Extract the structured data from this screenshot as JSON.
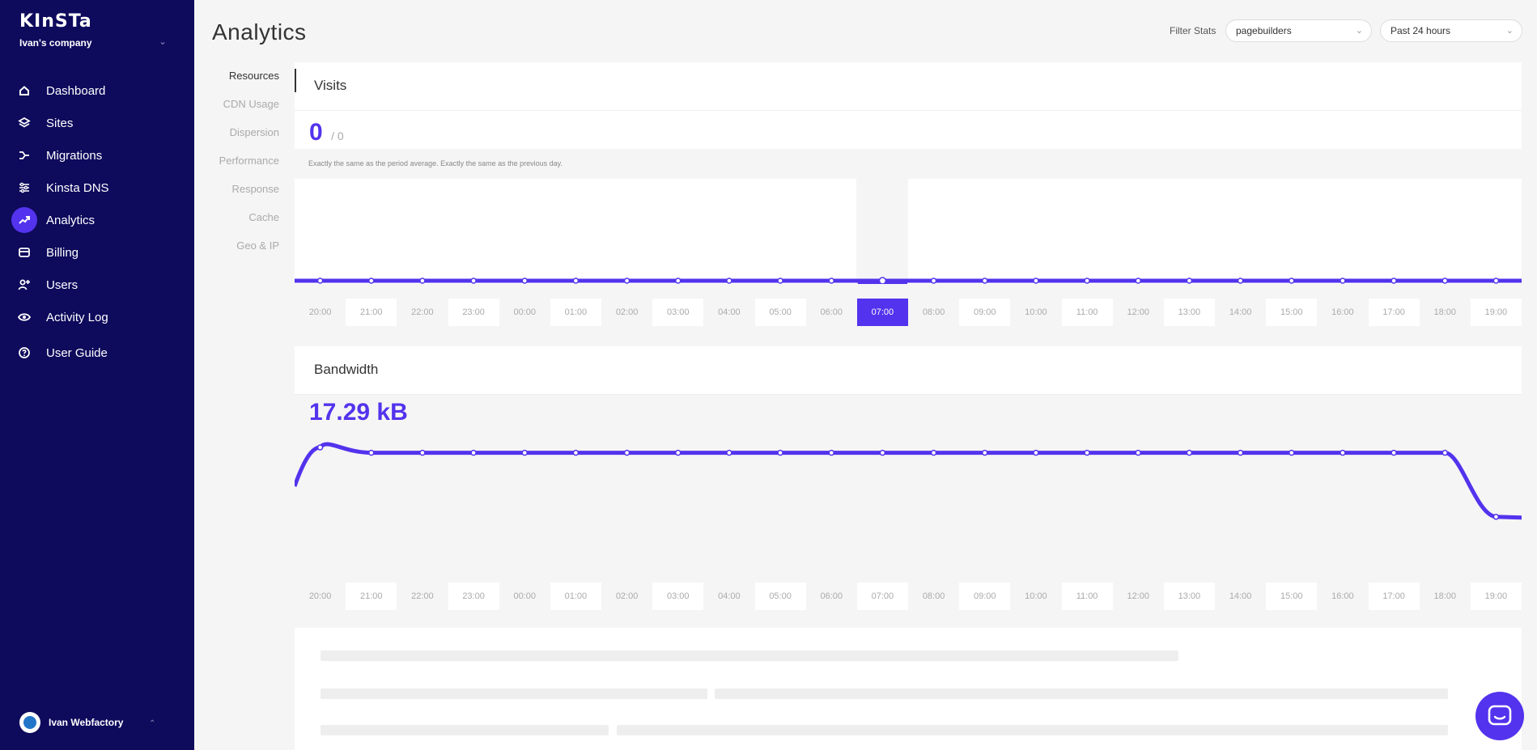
{
  "sidebar": {
    "brand": "KInSTa",
    "company": "Ivan's company",
    "items": [
      {
        "label": "Dashboard",
        "icon": "home-icon"
      },
      {
        "label": "Sites",
        "icon": "layers-icon"
      },
      {
        "label": "Migrations",
        "icon": "migrate-icon"
      },
      {
        "label": "Kinsta DNS",
        "icon": "dns-icon"
      },
      {
        "label": "Analytics",
        "icon": "analytics-icon",
        "active": true
      },
      {
        "label": "Billing",
        "icon": "billing-icon"
      },
      {
        "label": "Users",
        "icon": "add-user-icon"
      },
      {
        "label": "Activity Log",
        "icon": "eye-icon"
      },
      {
        "label": "User Guide",
        "icon": "help-icon"
      }
    ],
    "user_name": "Ivan Webfactory"
  },
  "header": {
    "title": "Analytics",
    "filter_label": "Filter Stats",
    "site_select": "pagebuilders",
    "range_select": "Past 24 hours"
  },
  "subnav": [
    "Resources",
    "CDN Usage",
    "Dispersion",
    "Performance",
    "Response",
    "Cache",
    "Geo & IP"
  ],
  "visits": {
    "title": "Visits",
    "value": "0",
    "secondary": "/ 0",
    "note": "Exactly the same as the period average. Exactly the same as the previous day.",
    "selected_hour": "07:00"
  },
  "bandwidth": {
    "title": "Bandwidth",
    "value": "17.29 kB"
  },
  "hours": [
    "20:00",
    "21:00",
    "22:00",
    "23:00",
    "00:00",
    "01:00",
    "02:00",
    "03:00",
    "04:00",
    "05:00",
    "06:00",
    "07:00",
    "08:00",
    "09:00",
    "10:00",
    "11:00",
    "12:00",
    "13:00",
    "14:00",
    "15:00",
    "16:00",
    "17:00",
    "18:00",
    "19:00"
  ],
  "chart_data": [
    {
      "type": "line",
      "x": [
        "20:00",
        "21:00",
        "22:00",
        "23:00",
        "00:00",
        "01:00",
        "02:00",
        "03:00",
        "04:00",
        "05:00",
        "06:00",
        "07:00",
        "08:00",
        "09:00",
        "10:00",
        "11:00",
        "12:00",
        "13:00",
        "14:00",
        "15:00",
        "16:00",
        "17:00",
        "18:00",
        "19:00"
      ],
      "series": [
        {
          "values": [
            0,
            0,
            0,
            0,
            0,
            0,
            0,
            0,
            0,
            0,
            0,
            0,
            0,
            0,
            0,
            0,
            0,
            0,
            0,
            0,
            0,
            0,
            0,
            0
          ]
        }
      ]
    },
    {
      "type": "area",
      "x": [
        "20:00",
        "21:00",
        "22:00",
        "23:00",
        "00:00",
        "01:00",
        "02:00",
        "03:00",
        "04:00",
        "05:00",
        "06:00",
        "07:00",
        "08:00",
        "09:00",
        "10:00",
        "11:00",
        "12:00",
        "13:00",
        "14:00",
        "15:00",
        "16:00",
        "17:00",
        "18:00",
        "19:00"
      ],
      "series": [
        {
          "values": [
            0.75,
            0.72,
            0.72,
            0.72,
            0.72,
            0.72,
            0.72,
            0.72,
            0.72,
            0.72,
            0.72,
            0.72,
            0.72,
            0.72,
            0.72,
            0.72,
            0.72,
            0.72,
            0.72,
            0.72,
            0.72,
            0.72,
            0.72,
            0.36
          ]
        }
      ]
    }
  ],
  "colors": {
    "accent": "#5333ed",
    "sidebar": "#0e0a5c"
  }
}
